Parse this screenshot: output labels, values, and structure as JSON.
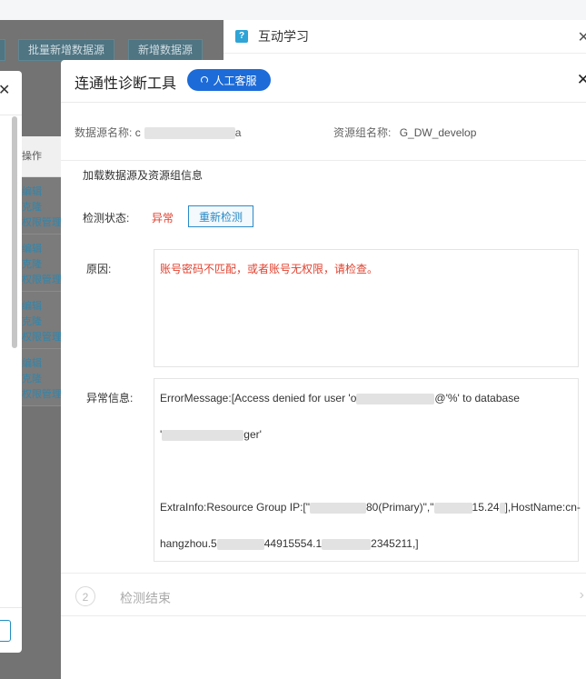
{
  "background": {
    "buttons": [
      "批量新增数据源",
      "新增数据源"
    ],
    "table_header": "操作",
    "row_links": [
      [
        "编辑",
        "克隆",
        "权限管理"
      ],
      [
        "编辑",
        "克隆",
        "权限管理"
      ],
      [
        "编辑",
        "克隆",
        "权限管理"
      ],
      [
        "编辑",
        "克隆",
        "权限管理"
      ]
    ]
  },
  "help_panel": {
    "icon_char": "?",
    "title": "互动学习",
    "close": "✕"
  },
  "modal": {
    "title": "连通性诊断工具",
    "customer_service": "人工客服",
    "close": "✕",
    "datasource_label": "数据源名称:",
    "datasource_value_prefix": "c",
    "datasource_value_suffix": "a",
    "resource_group_label": "资源组名称:",
    "resource_group_value": "G_DW_develop",
    "load_title": "加载数据源及资源组信息",
    "status_label": "检测状态:",
    "status_value": "异常",
    "redetect_button": "重新检测",
    "reason_label": "原因:",
    "reason_text": "账号密码不匹配，或者账号无权限，请检查。",
    "error_label": "异常信息:",
    "error_line1_a": "ErrorMessage:[Access denied for user 'o",
    "error_line1_b": "@'%' to database",
    "error_line2_a": "'",
    "error_line2_b": "ger'",
    "error_line3_a": "ExtraInfo:Resource Group IP:[\"",
    "error_line3_b": "80(Primary)\",\"",
    "error_line3_c": "15.24",
    "error_line3_d": "],HostName:cn-",
    "error_line4_a": "hangzhou.5",
    "error_line4_b": "44915554.1",
    "error_line4_c": "2345211,]",
    "step_number": "2",
    "step_label": "检测结束",
    "step_arrow": "›"
  },
  "colors": {
    "primary_blue": "#1c6bd8",
    "error_red": "#e0412f",
    "link_blue": "#2b8ac6"
  }
}
